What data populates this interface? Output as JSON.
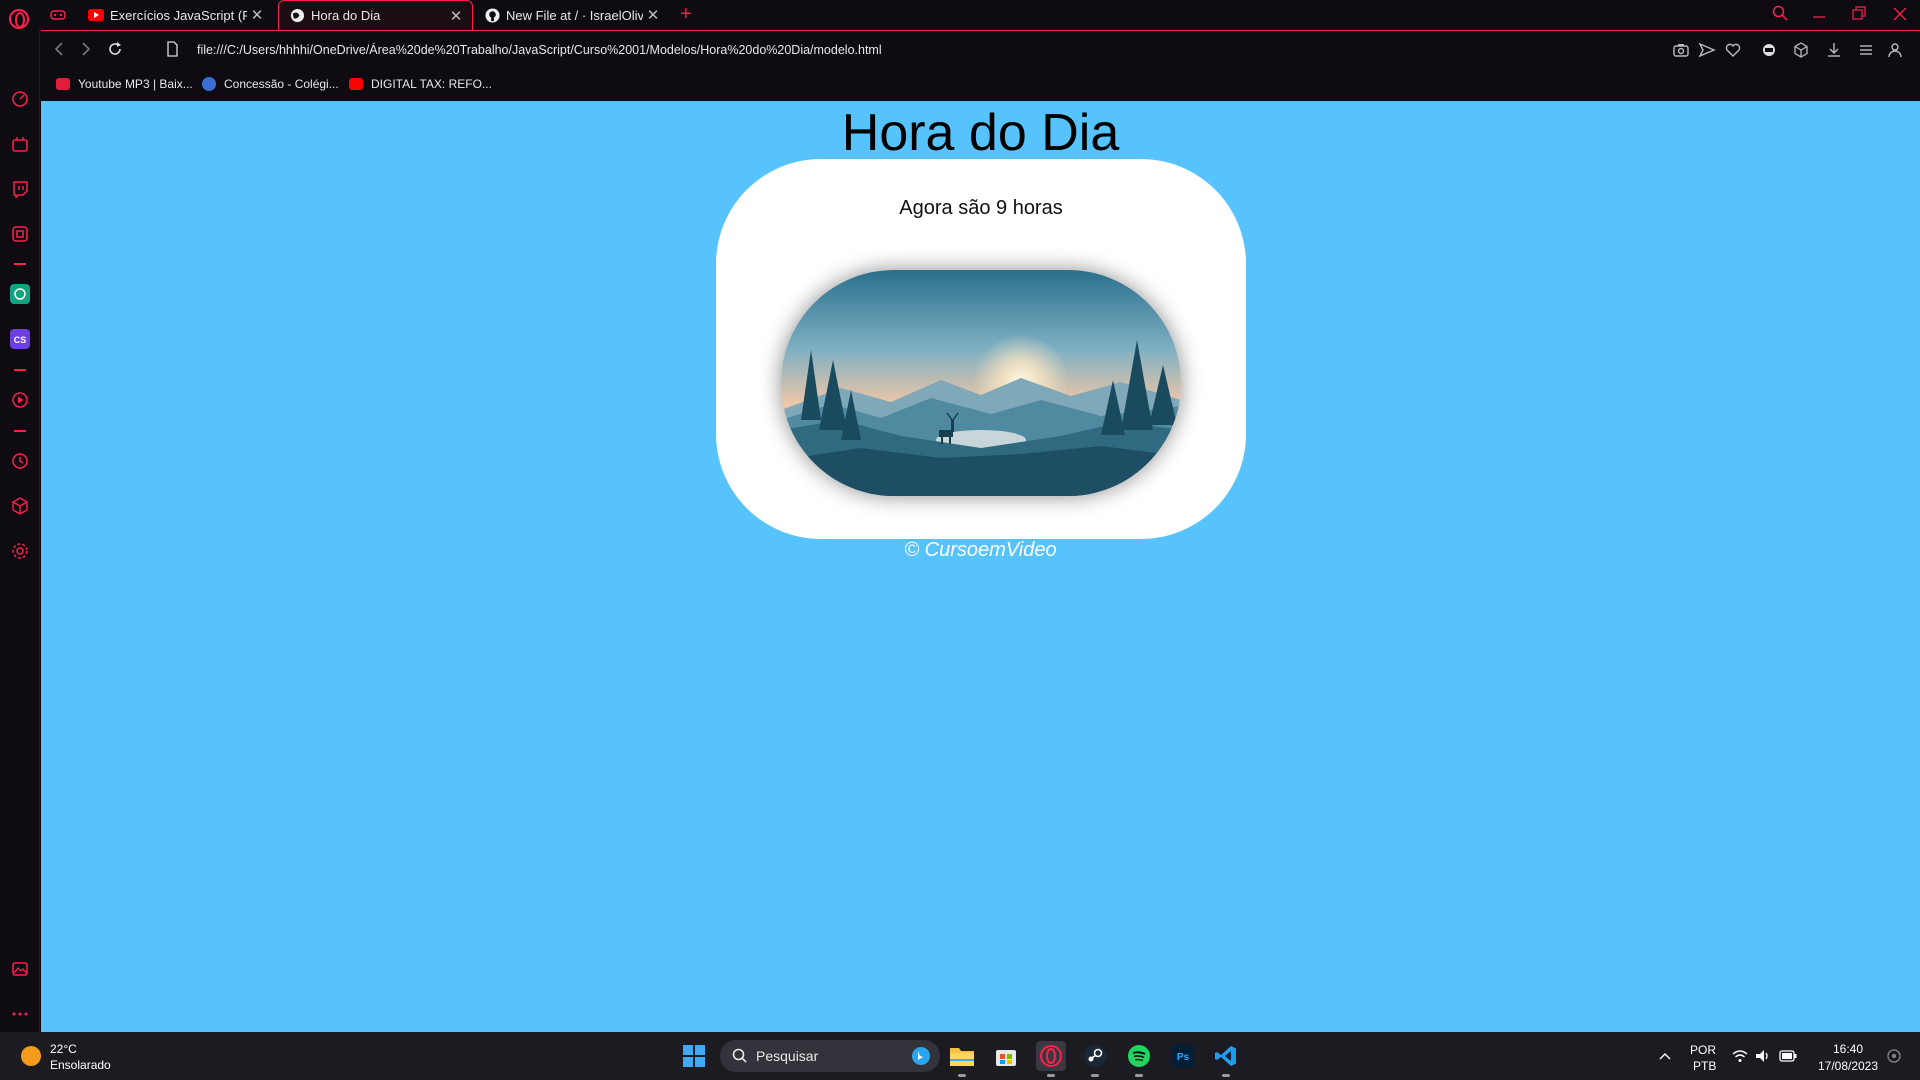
{
  "browser": {
    "tabs": [
      {
        "title": "Exercícios JavaScript (Parte",
        "favicon": "youtube-icon",
        "close": "✕"
      },
      {
        "title": "Hora do Dia",
        "favicon": "globe-icon",
        "close": "✕"
      },
      {
        "title": "New File at / · IsraelOliver/",
        "favicon": "github-icon",
        "close": "✕"
      }
    ],
    "new_tab": "+",
    "url": "file:///C:/Users/hhhhi/OneDrive/Área%20de%20Trabalho/JavaScript/Curso%2001/Modelos/Hora%20do%20Dia/modelo.html",
    "bookmarks": [
      {
        "label": "Youtube MP3 | Baix...",
        "icon": "youtube-mp3-icon"
      },
      {
        "label": "Concessão - Colégi...",
        "icon": "school-logo-icon"
      },
      {
        "label": "DIGITAL TAX: REFO...",
        "icon": "youtube-icon"
      }
    ],
    "accent_color": "#ff1f4b"
  },
  "page": {
    "heading": "Hora do Dia",
    "message": "Agora são 9 horas",
    "image": "morning-landscape-image",
    "footer": "© CursoemVideo",
    "background_color": "#56c3fc"
  },
  "taskbar": {
    "weather": {
      "temp": "22°C",
      "desc": "Ensolarado"
    },
    "search_label": "Pesquisar",
    "language": "POR",
    "layout": "PTB",
    "time": "16:40",
    "date": "17/08/2023",
    "apps": [
      "start-icon",
      "search-icon",
      "file-explorer-icon",
      "store-icon",
      "opera-gx-icon",
      "steam-icon",
      "spotify-icon",
      "photoshop-icon",
      "vscode-icon"
    ]
  }
}
